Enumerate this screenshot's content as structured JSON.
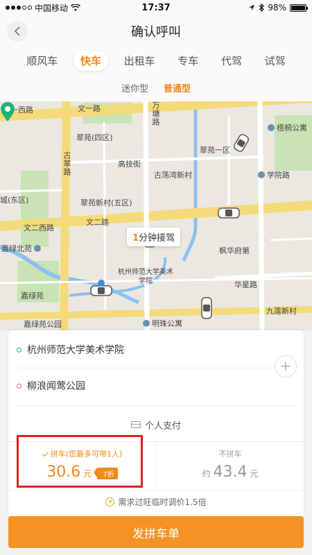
{
  "status_bar": {
    "carrier": "中国移动",
    "time": "17:37",
    "battery": "98%",
    "battery_level": 0.98
  },
  "header": {
    "title": "确认呼叫"
  },
  "tabs": [
    {
      "label": "顺风车"
    },
    {
      "label": "快车",
      "active": true
    },
    {
      "label": "出租车"
    },
    {
      "label": "专车"
    },
    {
      "label": "代驾"
    },
    {
      "label": "试驾"
    }
  ],
  "subtabs": [
    {
      "label": "迷你型"
    },
    {
      "label": "普通型",
      "active": true
    }
  ],
  "map": {
    "labels": {
      "wenyi_xilu": "文一西路",
      "wenyi_lu": "文一路",
      "wantang_lu": "万塘路",
      "cuiyuan_si": "翠苑(四区)",
      "gucui_lu": "古翠路",
      "gaoji_jie": "高技街",
      "cuiyuan_yiqu": "翠苑一区",
      "wutong_gongyu": "梧桐公寓",
      "xueyuan_lu": "学院路",
      "gudangwan_xincun": "古荡湾新村",
      "cheng_dongqu": "城(东区)",
      "cuiyuan_xincun": "翠苑新村(五区)",
      "wener_xilu": "文二西路",
      "wener_lu": "文二路",
      "jialv_beiyuan": "嘉绿北苑",
      "fenghua_fudi": "枫华府第",
      "hzsf_meishu": "杭州师范大学美术学院",
      "huaxing_lu": "华星路",
      "jialv_yuan": "嘉绿苑",
      "jiulian_xincun": "九莲新村",
      "jialvyuan_gongyuan": "嘉绿苑公园",
      "mingzhu_gongyu": "明珠公寓"
    },
    "pickup_minutes": "1",
    "pickup_suffix": "分钟接驾"
  },
  "trip": {
    "from": "杭州师范大学美术学院",
    "to": "柳浪闻莺公园",
    "add_icon": "plus-icon"
  },
  "payment": {
    "label": "个人支付"
  },
  "options": {
    "carpool": {
      "title": "拼车(您最多可带1人)",
      "price": "30.6",
      "unit": "元",
      "discount": "7折"
    },
    "no_carpool": {
      "title": "不拼车",
      "prefix": "约",
      "price": "43.4",
      "unit": "元"
    }
  },
  "surge": {
    "label": "需求过旺临时调价1.5倍"
  },
  "submit": {
    "label": "发拼车单"
  },
  "colors": {
    "accent": "#f08a1c",
    "button": "#f39324",
    "highlight": "#e0201e"
  }
}
